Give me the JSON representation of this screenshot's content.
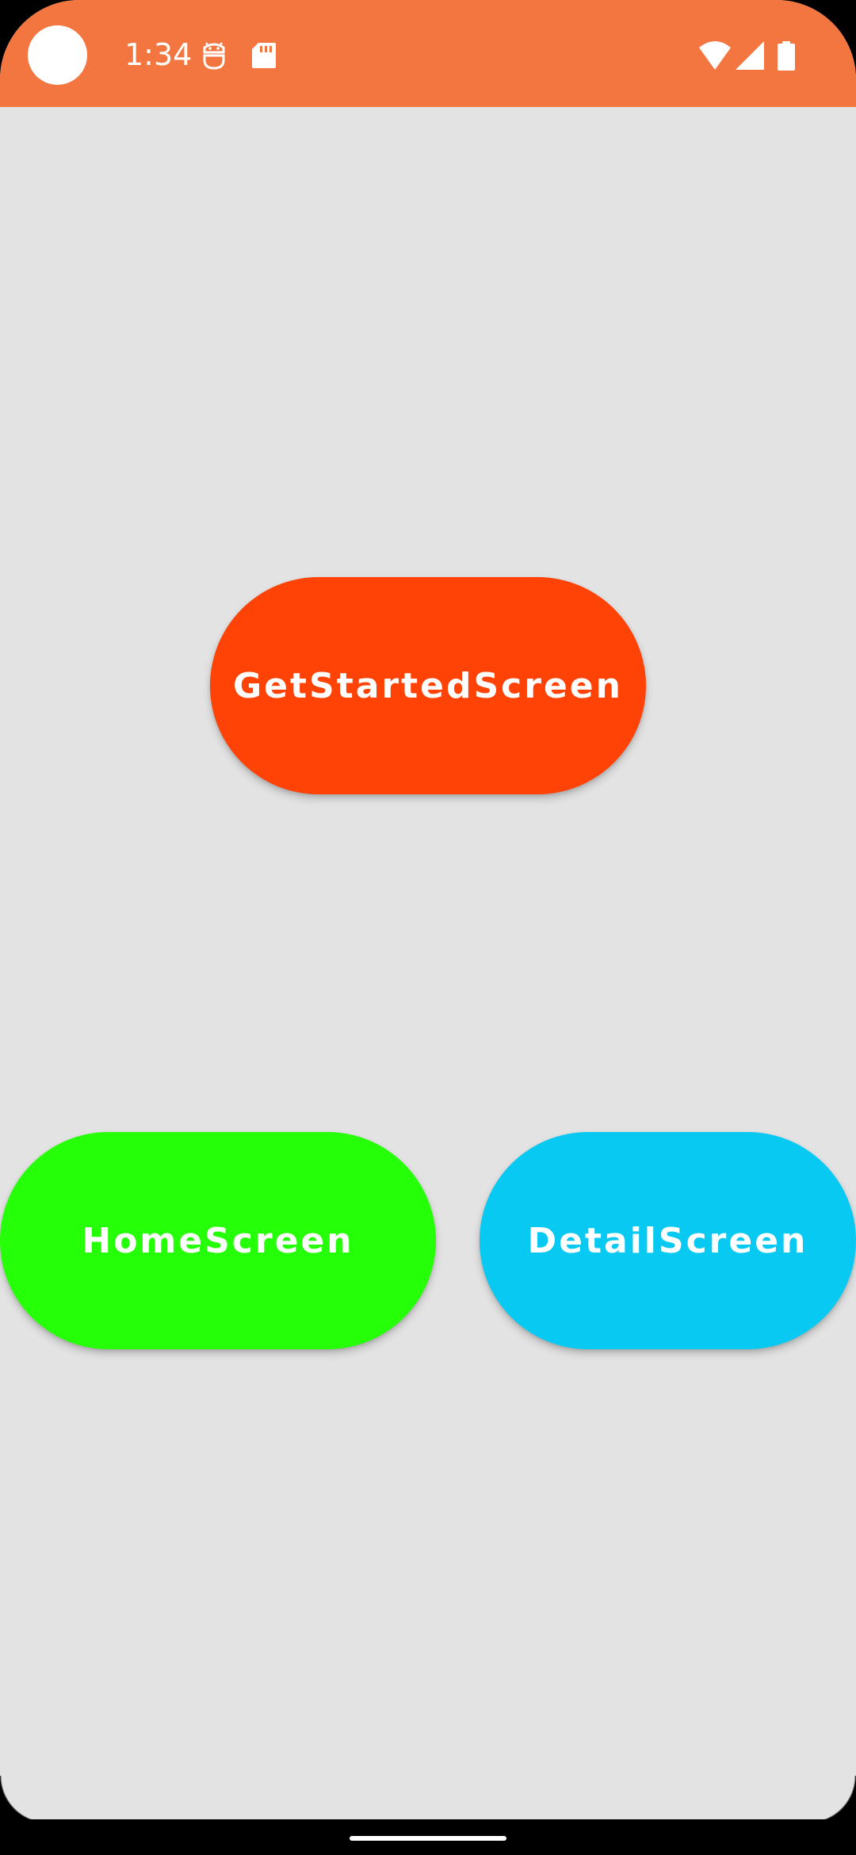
{
  "status_bar": {
    "time": "1:34",
    "background_color": "#f37640",
    "icons": [
      "camera-cutout",
      "android-debug-icon",
      "sd-card-icon",
      "wifi-icon",
      "signal-icon",
      "battery-icon"
    ]
  },
  "buttons": {
    "get_started": {
      "label": "GetStartedScreen",
      "color": "#ff4306"
    },
    "home": {
      "label": "HomeScreen",
      "color": "#25ff07"
    },
    "detail": {
      "label": "DetailScreen",
      "color": "#08c9f2"
    }
  },
  "screen": {
    "background_color": "#e3e3e3"
  }
}
